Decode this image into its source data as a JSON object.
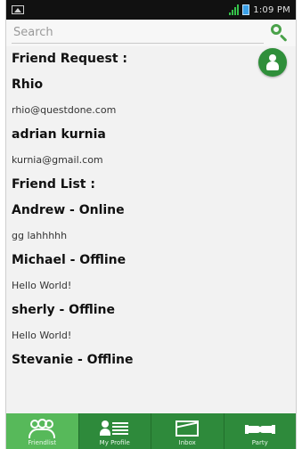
{
  "statusbar": {
    "time": "1:09 PM"
  },
  "search": {
    "placeholder": "Search"
  },
  "friend_requests": {
    "title": "Friend Request :",
    "items": [
      {
        "name": "Rhio",
        "email": "rhio@questdone.com"
      },
      {
        "name": "adrian kurnia",
        "email": "kurnia@gmail.com"
      }
    ]
  },
  "friend_list": {
    "title": "Friend List :",
    "items": [
      {
        "name": "Andrew - Online",
        "status": "gg lahhhhh"
      },
      {
        "name": "Michael - Offline",
        "status": "Hello World!"
      },
      {
        "name": "sherly - Offline",
        "status": "Hello World!"
      },
      {
        "name": "Stevanie - Offline",
        "status": ""
      }
    ]
  },
  "navbar": {
    "items": [
      {
        "label": "Friendlist",
        "icon": "friends-icon",
        "active": true
      },
      {
        "label": "My Profile",
        "icon": "profile-icon",
        "active": false
      },
      {
        "label": "Inbox",
        "icon": "inbox-icon",
        "active": false
      },
      {
        "label": "Party",
        "icon": "handshake-icon",
        "active": false
      }
    ]
  },
  "colors": {
    "accent": "#2e8a3b",
    "active_tab": "#57b95a",
    "statusbar": "#111111"
  }
}
